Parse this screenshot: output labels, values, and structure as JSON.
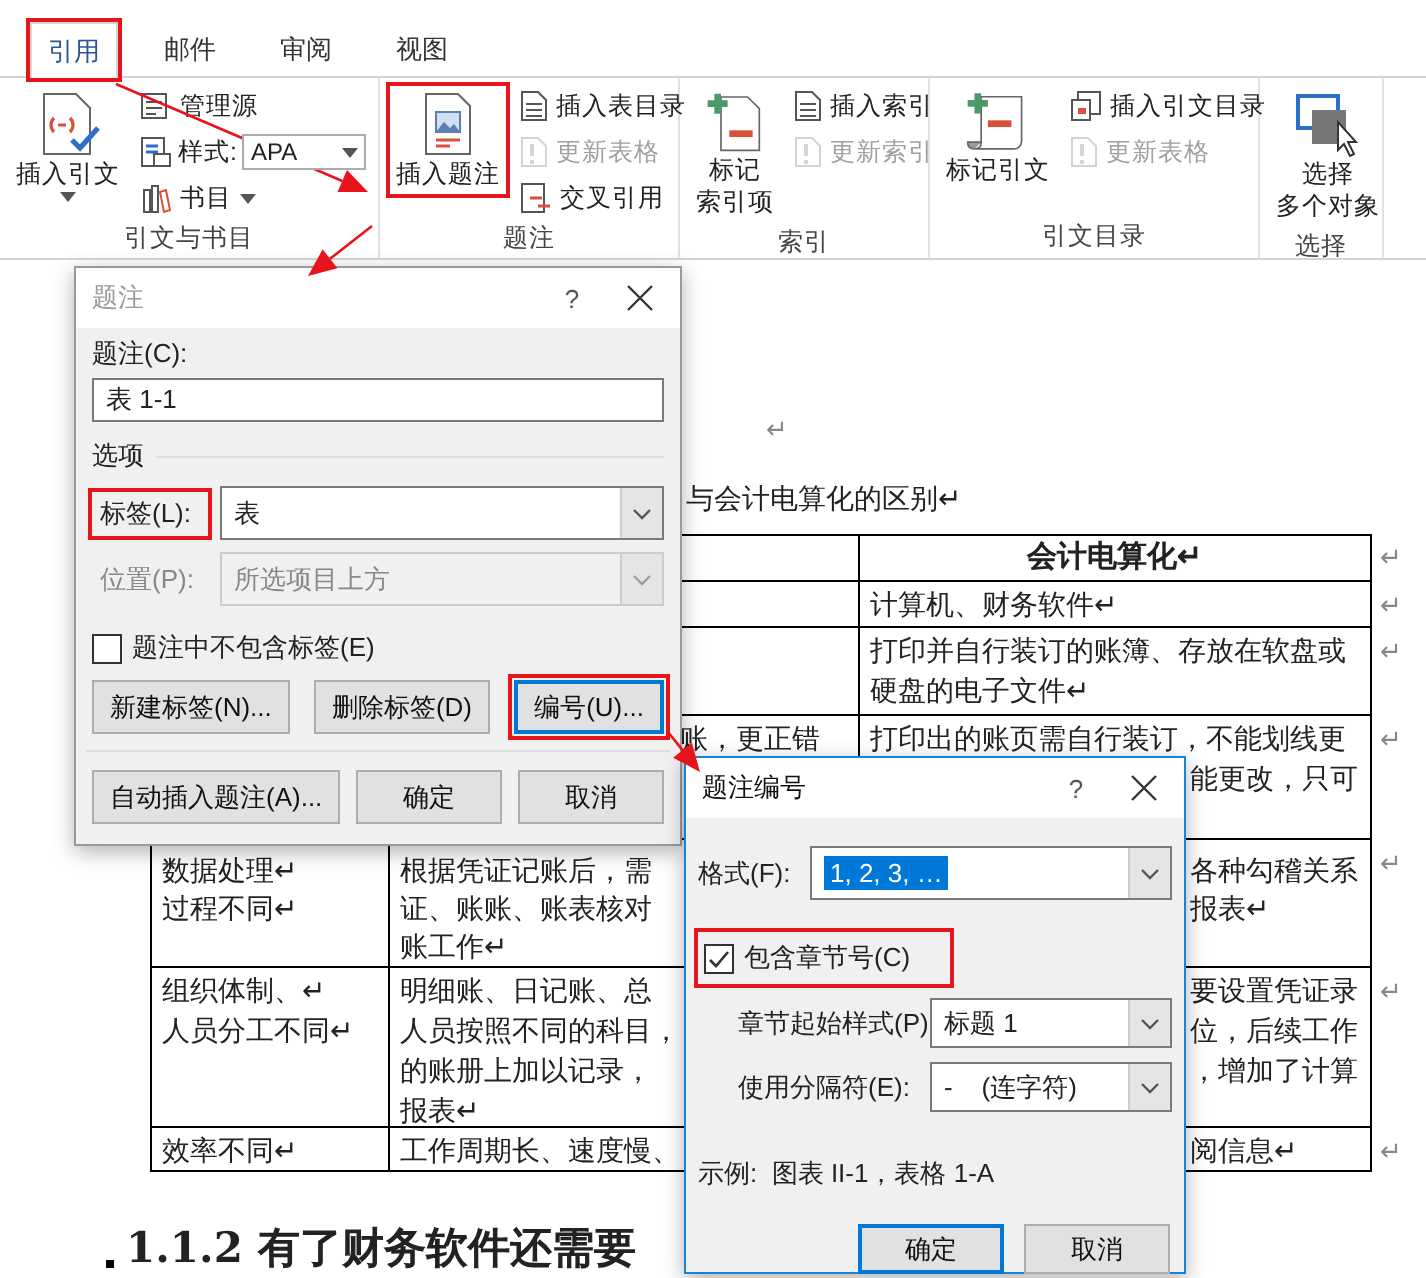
{
  "ribbon": {
    "tabs": [
      {
        "label": "引用",
        "selected": true,
        "annotated": true
      },
      {
        "label": "邮件",
        "selected": false,
        "annotated": false
      },
      {
        "label": "审阅",
        "selected": false,
        "annotated": false
      },
      {
        "label": "视图",
        "selected": false,
        "annotated": false
      }
    ],
    "groups": [
      {
        "label": "引文与书目",
        "large": [
          {
            "kind": "citation",
            "lines": [
              "插入引文"
            ],
            "dropdown": true,
            "annotated": false
          }
        ],
        "small": [
          {
            "kind": "sources",
            "label": "管理源",
            "disabled": false,
            "dropdown": false
          },
          {
            "kind": "style",
            "label": "样式:",
            "value": "APA",
            "disabled": false,
            "dropdown": true
          },
          {
            "kind": "bibliography",
            "label": "书目",
            "disabled": false,
            "dropdown": true
          }
        ]
      },
      {
        "label": "题注",
        "large": [
          {
            "kind": "caption",
            "lines": [
              "插入题注"
            ],
            "dropdown": false,
            "annotated": true
          }
        ],
        "small": [
          {
            "kind": "table-of-figures",
            "label": "插入表目录",
            "disabled": false,
            "dropdown": false
          },
          {
            "kind": "update",
            "label": "更新表格",
            "disabled": true,
            "dropdown": false
          },
          {
            "kind": "cross-reference",
            "label": "交叉引用",
            "disabled": false,
            "dropdown": false
          }
        ]
      },
      {
        "label": "索引",
        "large": [
          {
            "kind": "mark-entry",
            "lines": [
              "标记",
              "索引项"
            ],
            "dropdown": false,
            "annotated": false
          }
        ],
        "small": [
          {
            "kind": "index",
            "label": "插入索引",
            "disabled": false,
            "dropdown": false
          },
          {
            "kind": "update",
            "label": "更新索引",
            "disabled": true,
            "dropdown": false
          }
        ]
      },
      {
        "label": "引文目录",
        "large": [
          {
            "kind": "mark-citation",
            "lines": [
              "标记引文"
            ],
            "dropdown": false,
            "annotated": false
          }
        ],
        "small": [
          {
            "kind": "authorities",
            "label": "插入引文目录",
            "disabled": false,
            "dropdown": false
          },
          {
            "kind": "update",
            "label": "更新表格",
            "disabled": true,
            "dropdown": false
          }
        ]
      },
      {
        "label": "选择",
        "large": [
          {
            "kind": "select-objects",
            "lines": [
              "选择",
              "多个对象"
            ],
            "dropdown": false,
            "annotated": false
          }
        ]
      }
    ]
  },
  "document": {
    "empty_mark": "↵",
    "caption": "与会计电算化的区别↵",
    "table": {
      "rows": [
        {
          "kind": "header",
          "end_mark": "↵",
          "column_3": [
            "会计电算化↵"
          ]
        },
        {
          "kind": "body",
          "end_mark": "↵",
          "column_3": [
            "计算机、财务软件↵"
          ]
        },
        {
          "kind": "body",
          "end_mark": "↵",
          "column_3": [
            "打印并自行装订的账簿、存放在软盘或",
            "硬盘的电子文件↵"
          ]
        },
        {
          "kind": "body",
          "end_mark": "↵",
          "column_2": [
            "账，更正错"
          ],
          "column_3": [
            "打印出的账页需自行装订，不能划线更",
            "能更改，只可"
          ]
        },
        {
          "kind": "body",
          "end_mark": "↵",
          "column_1": [
            "数据处理↵",
            "过程不同↵"
          ],
          "column_2": [
            "根据凭证记账后，需",
            "证、账账、账表核对",
            "账工作↵"
          ],
          "column_3": [
            "各种勾稽关系",
            "报表↵"
          ]
        },
        {
          "kind": "body",
          "end_mark": "↵",
          "column_1": [
            "组织体制、↵",
            "人员分工不同↵"
          ],
          "column_2": [
            "明细账、日记账、总",
            "人员按照不同的科目，",
            "的账册上加以记录，",
            "报表↵"
          ],
          "column_3": [
            "要设置凭证录",
            "位，后续工作",
            "，增加了计算"
          ]
        },
        {
          "kind": "body",
          "end_mark": "↵",
          "column_1": [
            "效率不同↵"
          ],
          "column_2": [
            "工作周期长、速度慢、"
          ],
          "column_3": [
            "阅信息↵"
          ]
        }
      ]
    },
    "heading": "1.1.2 有了财务软件还需要"
  },
  "caption_dialog": {
    "title": "题注",
    "active": false,
    "help": "?",
    "caption_label": "题注(C):",
    "caption_value": "表 1-1",
    "options_heading": "选项",
    "selects": [
      {
        "label": "标签(L):",
        "value": "表",
        "disabled": false,
        "annotated": true
      },
      {
        "label": "位置(P):",
        "value": "所选项目上方",
        "disabled": true,
        "annotated": false
      }
    ],
    "exclude_label": {
      "label": "题注中不包含标签(E)",
      "checked": false
    },
    "button_rows": [
      {
        "buttons": [
          {
            "label": "新建标签(N)...",
            "default": false,
            "annotated": false
          },
          {
            "label": "删除标签(D)",
            "default": false,
            "annotated": false
          },
          {
            "label": "编号(U)...",
            "default": true,
            "annotated": true
          }
        ]
      },
      {
        "buttons": [
          {
            "label": "自动插入题注(A)...",
            "default": false,
            "annotated": false
          },
          {
            "label": "确定",
            "default": false,
            "annotated": false
          },
          {
            "label": "取消",
            "default": false,
            "annotated": false
          }
        ]
      }
    ]
  },
  "numbering_dialog": {
    "title": "题注编号",
    "active": true,
    "help": "?",
    "format": {
      "label": "格式(F):",
      "value": "1, 2, 3, …",
      "selected": true
    },
    "include_chapter": {
      "label": "包含章节号(C)",
      "checked": true,
      "annotated": true
    },
    "selects": [
      {
        "label": "章节起始样式(P)",
        "value": "标题 1"
      },
      {
        "label": "使用分隔符(E):",
        "value": "-    (连字符)"
      }
    ],
    "example": "示例:  图表 II-1，表格 1-A",
    "buttons": [
      {
        "label": "确定",
        "default": true
      },
      {
        "label": "取消",
        "default": false
      }
    ]
  }
}
